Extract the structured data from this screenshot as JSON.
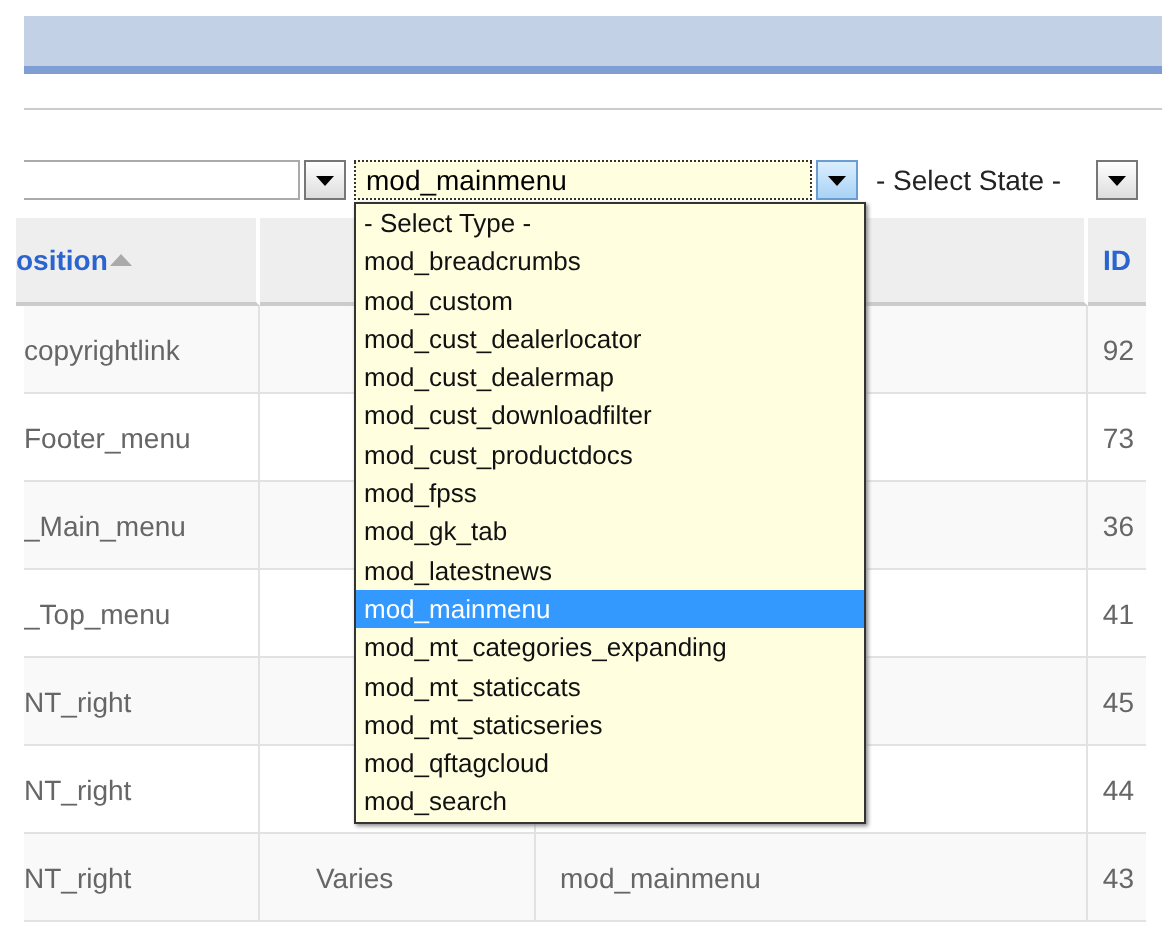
{
  "filters": [
    {
      "kind": "blank"
    },
    {
      "kind": "type",
      "value": "mod_mainmenu",
      "open": true,
      "options": [
        {
          "label": "- Select Type -",
          "selected": false
        },
        {
          "label": "mod_breadcrumbs",
          "selected": false
        },
        {
          "label": "mod_custom",
          "selected": false
        },
        {
          "label": "mod_cust_dealerlocator",
          "selected": false
        },
        {
          "label": "mod_cust_dealermap",
          "selected": false
        },
        {
          "label": "mod_cust_downloadfilter",
          "selected": false
        },
        {
          "label": "mod_cust_productdocs",
          "selected": false
        },
        {
          "label": "mod_fpss",
          "selected": false
        },
        {
          "label": "mod_gk_tab",
          "selected": false
        },
        {
          "label": "mod_latestnews",
          "selected": false
        },
        {
          "label": "mod_mainmenu",
          "selected": true
        },
        {
          "label": "mod_mt_categories_expanding",
          "selected": false
        },
        {
          "label": "mod_mt_staticcats",
          "selected": false
        },
        {
          "label": "mod_mt_staticseries",
          "selected": false
        },
        {
          "label": "mod_qftagcloud",
          "selected": false
        },
        {
          "label": "mod_search",
          "selected": false
        }
      ]
    },
    {
      "kind": "state",
      "value": "- Select State -"
    }
  ],
  "table": {
    "position_header": "osition",
    "sorted": true,
    "id_header": "ID",
    "rows": [
      {
        "position": "copyrightlink",
        "id": "92"
      },
      {
        "position": "Footer_menu",
        "id": "73"
      },
      {
        "position": "_Main_menu",
        "id": "36"
      },
      {
        "position": "_Top_menu",
        "id": "41"
      },
      {
        "position": "NT_right",
        "id": "45"
      },
      {
        "position": "NT_right",
        "id": "44"
      },
      {
        "position": "NT_right",
        "column_2": "Varies",
        "column_3": "mod_mainmenu",
        "id": "43"
      }
    ]
  }
}
